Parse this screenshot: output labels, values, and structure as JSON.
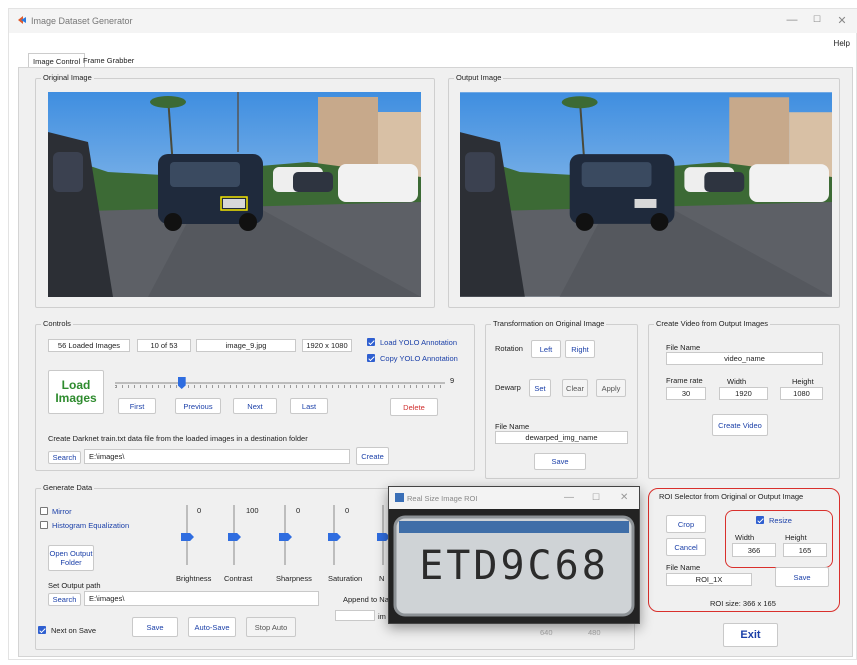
{
  "window": {
    "title": "Image Dataset Generator",
    "min": "—",
    "max": "☐",
    "close": "✕",
    "help": "Help"
  },
  "tabs": [
    "Image Control",
    "Frame Grabber"
  ],
  "original_image": {
    "label": "Original Image",
    "plate_text": "ETD9C68"
  },
  "output_image": {
    "label": "Output Image"
  },
  "controls": {
    "label": "Controls",
    "loaded": "56 Loaded Images",
    "index": "10 of 53",
    "filename": "image_9.jpg",
    "resolution": "1920 x 1080",
    "load_yolo": "Load YOLO Annotation",
    "copy_yolo": "Copy YOLO Annotation",
    "load_images": "Load\nImages",
    "slider_value": "9",
    "slider_fraction": 0.19,
    "first": "First",
    "previous": "Previous",
    "next": "Next",
    "last": "Last",
    "delete": "Delete",
    "darknet_text": "Create Darknet train.txt data file from the loaded images in a destination folder",
    "search": "Search",
    "path": "E:\\images\\",
    "create": "Create"
  },
  "transform": {
    "label": "Transformation on Original Image",
    "rotation": "Rotation",
    "left": "Left",
    "right": "Right",
    "dewarp": "Dewarp",
    "set": "Set",
    "clear": "Clear",
    "apply": "Apply",
    "file_name_label": "File Name",
    "file_name": "dewarped_img_name",
    "save": "Save"
  },
  "video": {
    "label": "Create Video from Output Images",
    "file_name_label": "File Name",
    "file_name": "video_name",
    "frame_rate_label": "Frame rate",
    "frame_rate": "30",
    "width_label": "Width",
    "width": "1920",
    "height_label": "Height",
    "height": "1080",
    "create": "Create Video"
  },
  "generate": {
    "label": "Generate Data",
    "mirror": "Mirror",
    "histogram": "Histogram Equalization",
    "open_output": "Open Output\nFolder",
    "set_output": "Set Output path",
    "search": "Search",
    "path": "E:\\images\\",
    "next_on_save": "Next on Save",
    "save": "Save",
    "auto_save": "Auto-Save",
    "stop_auto": "Stop Auto",
    "append": "Append to Na",
    "im": "im",
    "sliders": [
      {
        "name": "Brightness",
        "value": "0"
      },
      {
        "name": "Contrast",
        "value": "100"
      },
      {
        "name": "Sharpness",
        "value": "0"
      },
      {
        "name": "Saturation",
        "value": "0"
      },
      {
        "name": "N"
      }
    ],
    "dim_w": "640",
    "dim_h": "480"
  },
  "roi": {
    "label": "ROI Selector from Original or Output Image",
    "crop": "Crop",
    "cancel": "Cancel",
    "resize": "Resize",
    "width_label": "Width",
    "width": "366",
    "height_label": "Height",
    "height": "165",
    "file_name_label": "File Name",
    "file_name": "ROI_1X",
    "save": "Save",
    "size": "ROI size: 366 x 165",
    "highlight_color": "#d9302c"
  },
  "popup": {
    "title": "Real Size Image ROI",
    "plate": "ETD9C68"
  },
  "exit": "Exit"
}
